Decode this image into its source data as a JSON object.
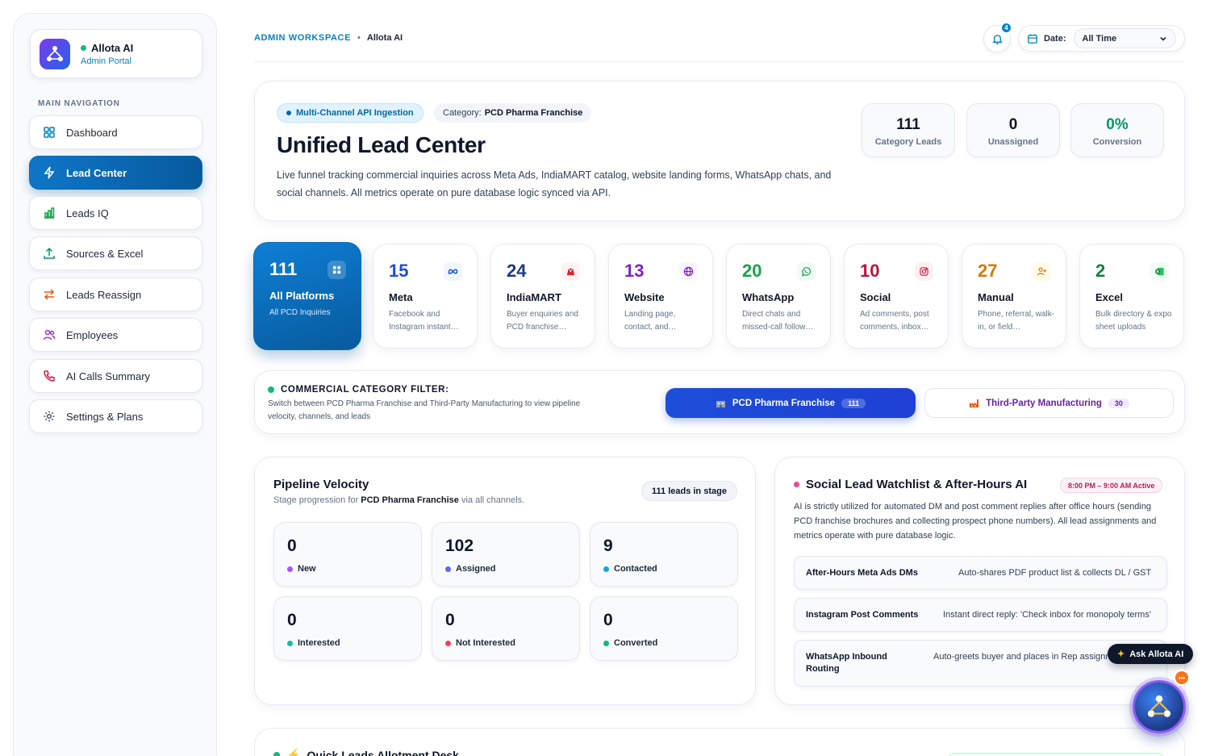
{
  "brand": {
    "name": "Allota AI",
    "subtitle": "Admin Portal"
  },
  "sidebar": {
    "heading": "MAIN NAVIGATION",
    "items": [
      {
        "label": "Dashboard",
        "icon": "grid-icon"
      },
      {
        "label": "Lead Center",
        "icon": "bolt-icon",
        "active": true
      },
      {
        "label": "Leads IQ",
        "icon": "bar-chart-icon"
      },
      {
        "label": "Sources & Excel",
        "icon": "upload-icon"
      },
      {
        "label": "Leads Reassign",
        "icon": "swap-icon"
      },
      {
        "label": "Employees",
        "icon": "users-icon"
      },
      {
        "label": "AI Calls Summary",
        "icon": "phone-icon"
      },
      {
        "label": "Settings & Plans",
        "icon": "gear-icon"
      }
    ]
  },
  "header": {
    "breadcrumb_workspace": "ADMIN WORKSPACE",
    "breadcrumb_sep": "•",
    "breadcrumb_app": "Allota AI",
    "notification_count": "4",
    "date_label": "Date:",
    "date_value": "All Time"
  },
  "hero": {
    "chip_api": "Multi-Channel API Ingestion",
    "chip_category_label": "Category:",
    "chip_category_value": "PCD Pharma Franchise",
    "title": "Unified Lead Center",
    "description": "Live funnel tracking commercial inquiries across Meta Ads, IndiaMART catalog, website landing forms, WhatsApp chats, and social channels. All metrics operate on pure database logic synced via API.",
    "kpis": [
      {
        "value": "111",
        "label": "Category Leads",
        "color": "#0f172a"
      },
      {
        "value": "0",
        "label": "Unassigned",
        "color": "#0f172a"
      },
      {
        "value": "0%",
        "label": "Conversion",
        "color": "#059669"
      }
    ]
  },
  "platforms": [
    {
      "count": "111",
      "name": "All Platforms",
      "desc": "All PCD Inquiries",
      "color": "#ffffff",
      "icon": "grid-icon"
    },
    {
      "count": "15",
      "name": "Meta",
      "desc": "Facebook and Instagram instant…",
      "color": "#1d4ed8",
      "icon": "meta-icon"
    },
    {
      "count": "24",
      "name": "IndiaMART",
      "desc": "Buyer enquiries and PCD franchise…",
      "color": "#1e3a8a",
      "icon": "indiamart-icon"
    },
    {
      "count": "13",
      "name": "Website",
      "desc": "Landing page, contact, and…",
      "color": "#7e22ce",
      "icon": "globe-icon"
    },
    {
      "count": "20",
      "name": "WhatsApp",
      "desc": "Direct chats and missed-call follow…",
      "color": "#16a34a",
      "icon": "whatsapp-icon"
    },
    {
      "count": "10",
      "name": "Social",
      "desc": "Ad comments, post comments, inbox…",
      "color": "#be123c",
      "icon": "instagram-icon"
    },
    {
      "count": "27",
      "name": "Manual",
      "desc": "Phone, referral, walk-in, or field…",
      "color": "#d97706",
      "icon": "user-plus-icon"
    },
    {
      "count": "2",
      "name": "Excel",
      "desc": "Bulk directory & expo sheet uploads",
      "color": "#15803d",
      "icon": "excel-icon"
    }
  ],
  "filter": {
    "title": "COMMERCIAL CATEGORY FILTER:",
    "desc": "Switch between PCD Pharma Franchise and Third-Party Manufacturing to view pipeline velocity, channels, and leads",
    "options": [
      {
        "label": "PCD Pharma Franchise",
        "count": "111",
        "active": true
      },
      {
        "label": "Third-Party Manufacturing",
        "count": "30",
        "active": false
      }
    ]
  },
  "pipeline": {
    "title": "Pipeline Velocity",
    "sub_prefix": "Stage progression for",
    "sub_bold": "PCD Pharma Franchise",
    "sub_suffix": "via all channels.",
    "badge": "111 leads in stage",
    "stages": [
      {
        "value": "0",
        "label": "New",
        "color": "#a855f7"
      },
      {
        "value": "102",
        "label": "Assigned",
        "color": "#6366f1"
      },
      {
        "value": "9",
        "label": "Contacted",
        "color": "#0ea5e9"
      },
      {
        "value": "0",
        "label": "Interested",
        "color": "#14b8a6"
      },
      {
        "value": "0",
        "label": "Not Interested",
        "color": "#f43f5e"
      },
      {
        "value": "0",
        "label": "Converted",
        "color": "#10b981"
      }
    ]
  },
  "watchlist": {
    "title": "Social Lead Watchlist & After-Hours AI",
    "badge": "8:00 PM – 9:00 AM Active",
    "desc": "AI is strictly utilized for automated DM and post comment replies after office hours (sending PCD franchise brochures and collecting prospect phone numbers). All lead assignments and metrics operate with pure database logic.",
    "rows": [
      {
        "key": "After-Hours Meta Ads DMs",
        "value": "Auto-shares PDF product list & collects DL / GST"
      },
      {
        "key": "Instagram Post Comments",
        "value": "Instant direct reply: 'Check inbox for monopoly terms'"
      },
      {
        "key": "WhatsApp Inbound Routing",
        "value": "Auto-greets buyer and places in Rep assignment queue"
      }
    ]
  },
  "quick": {
    "title": "Quick Leads Allotment Desk"
  },
  "assistant": {
    "label": "Ask Allota AI",
    "badge": "•••"
  }
}
